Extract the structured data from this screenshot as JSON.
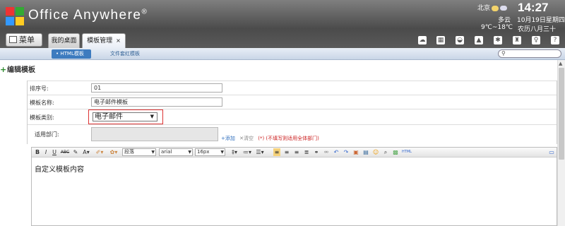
{
  "brand": {
    "name": "Office Anywhere",
    "reg": "®"
  },
  "weather": {
    "city": "北京",
    "condition": "多云",
    "temp": "9℃~18℃"
  },
  "clock": {
    "time": "14:27",
    "date": "10月19日星期四",
    "lunar": "农历八月三十"
  },
  "menu_button": {
    "label": "菜单",
    "icon": "home-icon"
  },
  "tabs": [
    {
      "label": "我的桌面",
      "active": false
    },
    {
      "label": "模板管理",
      "active": true,
      "close": "×"
    }
  ],
  "toolbar_icons": [
    "cloud-icon",
    "grid-icon",
    "hat-icon",
    "upload-icon",
    "gear-icon",
    "shirt-icon",
    "key-icon",
    "question-icon"
  ],
  "subtabs": [
    {
      "label": "HTML模板",
      "active": true
    },
    {
      "label": "文件套红模板",
      "active": false
    }
  ],
  "search": {
    "placeholder": "",
    "icon": "search-icon"
  },
  "page_title": "编辑模板",
  "form": {
    "sort_label": "排序号:",
    "sort_value": "01",
    "name_label": "模板名称:",
    "name_value": "电子邮件模板",
    "type_label": "模板类别:",
    "type_value": "电子邮件",
    "dept_label": "适用部门:",
    "dept_add": "添加",
    "dept_clear": "清空",
    "dept_note": "(*) (不填写则适用全体部门)"
  },
  "editor": {
    "bold": "B",
    "italic": "I",
    "underline": "U",
    "strike": "ABC",
    "paragraph": "段落",
    "font": "arial",
    "size": "16px",
    "content": "自定义模板内容"
  },
  "colors": {
    "accent": "#3d7bbf",
    "topbar": "#5a5a5a",
    "highlight": "#d33333"
  }
}
